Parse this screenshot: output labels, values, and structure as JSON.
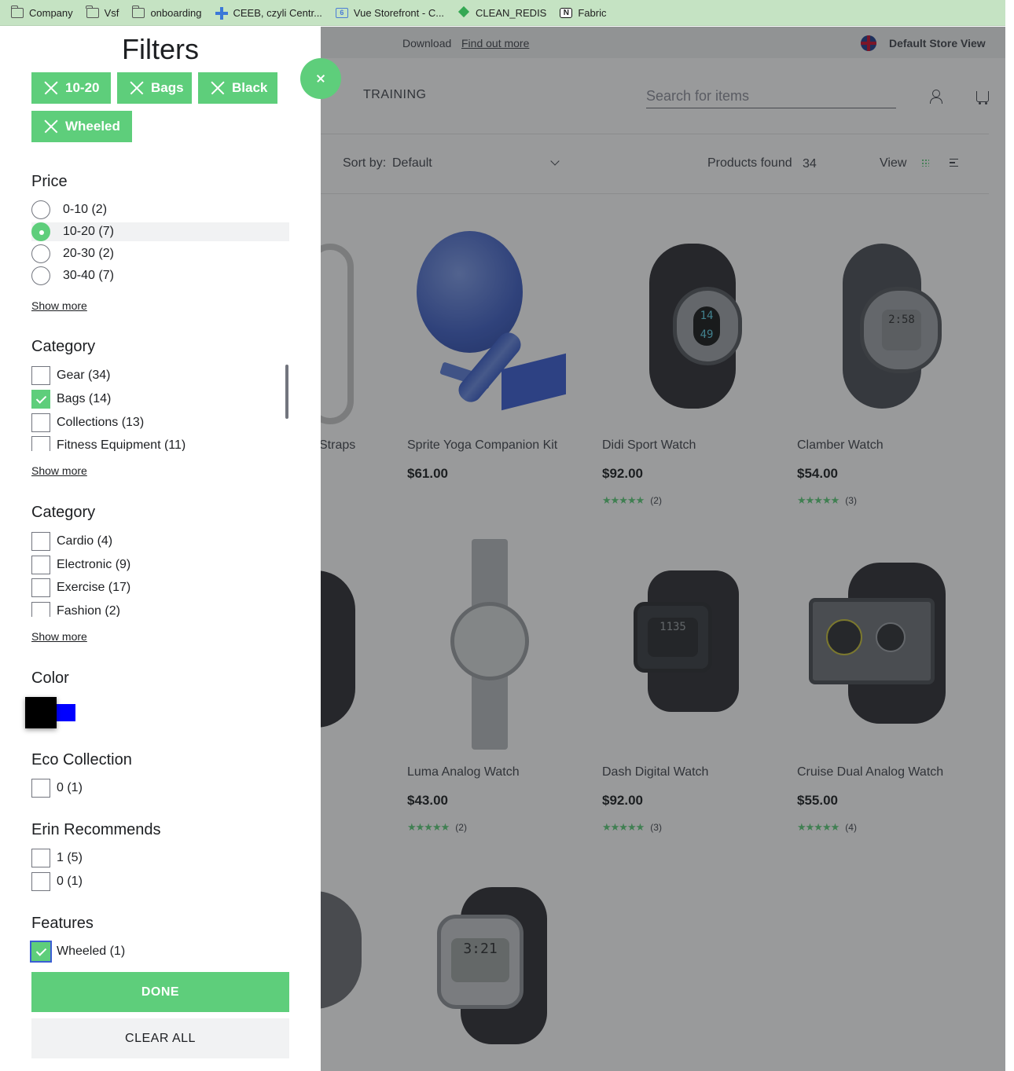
{
  "bookmarks": [
    {
      "label": "Company",
      "icon": "folder-icon"
    },
    {
      "label": "Vsf",
      "icon": "folder-icon"
    },
    {
      "label": "onboarding",
      "icon": "folder-icon"
    },
    {
      "label": "CEEB, czyli Centr...",
      "icon": "plus-icon"
    },
    {
      "label": "Vue Storefront - C...",
      "icon": "calendar-icon"
    },
    {
      "label": "CLEAN_REDIS",
      "icon": "diamond-icon"
    },
    {
      "label": "Fabric",
      "icon": "notion-icon"
    }
  ],
  "topbar": {
    "download": "Download",
    "find_out_more": "Find out more",
    "store_view": "Default Store View"
  },
  "header": {
    "nav_training": "TRAINING",
    "search_placeholder": "Search for items"
  },
  "toolbar": {
    "sort_label": "Sort by:",
    "sort_value": "Default",
    "found_label": "Products found",
    "found_count": "34",
    "view_label": "View"
  },
  "products": [
    {
      "name": "Straps",
      "price": "",
      "rating_count": ""
    },
    {
      "name": "Sprite Yoga Companion Kit",
      "price": "$61.00",
      "rating_count": ""
    },
    {
      "name": "Didi Sport Watch",
      "price": "$92.00",
      "rating_count": "(2)"
    },
    {
      "name": "Clamber Watch",
      "price": "$54.00",
      "rating_count": "(3)"
    },
    {
      "name": "Luma Analog Watch",
      "price": "$43.00",
      "rating_count": "(2)"
    },
    {
      "name": "Dash Digital Watch",
      "price": "$92.00",
      "rating_count": "(3)"
    },
    {
      "name": "Cruise Dual Analog Watch",
      "price": "$55.00",
      "rating_count": "(4)"
    }
  ],
  "stars": "★★★★★",
  "sidebar": {
    "title": "Filters",
    "chips": [
      "10-20",
      "Bags",
      "Black",
      "Wheeled"
    ],
    "price": {
      "heading": "Price",
      "options": [
        "0-10 (2)",
        "10-20 (7)",
        "20-30 (2)",
        "30-40 (7)"
      ],
      "selected": "10-20 (7)"
    },
    "category1": {
      "heading": "Category",
      "options": [
        "Gear (34)",
        "Bags (14)",
        "Collections (13)",
        "Fitness Equipment (11)"
      ],
      "checked": [
        "Bags (14)"
      ]
    },
    "category2": {
      "heading": "Category",
      "options": [
        "Cardio (4)",
        "Electronic (9)",
        "Exercise (17)",
        "Fashion (2)"
      ]
    },
    "show_more": "Show more",
    "color": {
      "heading": "Color",
      "swatches": [
        "#000000",
        "#0000ff"
      ]
    },
    "eco": {
      "heading": "Eco Collection",
      "options": [
        "0 (1)"
      ]
    },
    "erin": {
      "heading": "Erin Recommends",
      "options": [
        "1 (5)",
        "0 (1)"
      ]
    },
    "features": {
      "heading": "Features",
      "options": [
        "Wheeled (1)"
      ],
      "checked": [
        "Wheeled (1)"
      ]
    },
    "done": "DONE",
    "clear_all": "CLEAR ALL"
  },
  "colors": {
    "accent": "#5ece7b",
    "overlay": "#1d1f22"
  }
}
